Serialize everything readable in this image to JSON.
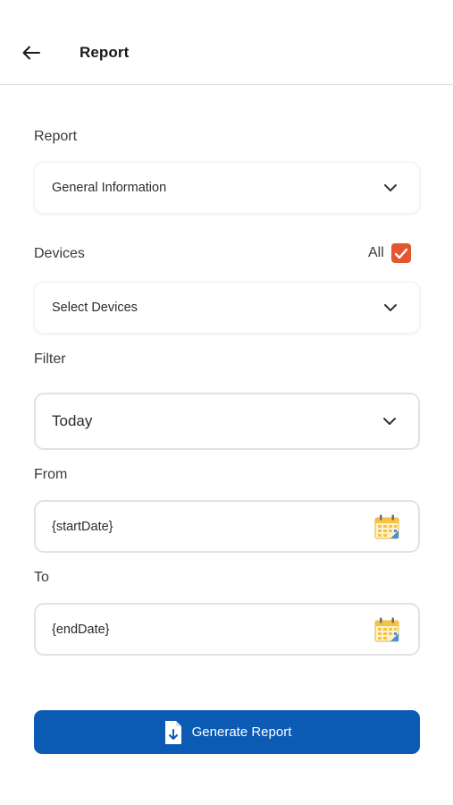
{
  "header": {
    "title": "Report",
    "back_icon": "arrow-left-icon"
  },
  "report": {
    "label": "Report",
    "selected": "General Information"
  },
  "devices": {
    "label": "Devices",
    "all_label": "All",
    "all_checked": true,
    "placeholder": "Select Devices"
  },
  "filter": {
    "label": "Filter",
    "selected": "Today"
  },
  "from": {
    "label": "From",
    "value": "{startDate}"
  },
  "to": {
    "label": "To",
    "value": "{endDate}"
  },
  "generate": {
    "label": "Generate Report",
    "icon": "file-download-icon"
  },
  "colors": {
    "primary": "#0b5bb5",
    "checkbox": "#e4572e",
    "calendar_yellow": "#f5c242",
    "calendar_blue": "#4a90d9"
  }
}
